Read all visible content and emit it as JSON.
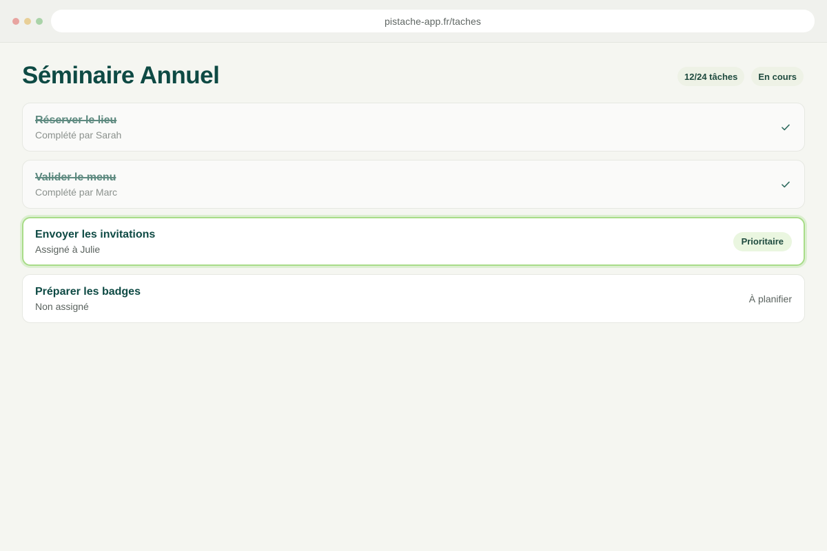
{
  "browser": {
    "url": "pistache-app.fr/taches"
  },
  "header": {
    "title": "Séminaire Annuel",
    "progress_label": "12/24 tâches",
    "status_label": "En cours"
  },
  "tasks": [
    {
      "title": "Réserver le lieu",
      "subtitle": "Complété par Sarah",
      "state": "done",
      "icon": "check-icon"
    },
    {
      "title": "Valider le menu",
      "subtitle": "Complété par Marc",
      "state": "done",
      "icon": "check-icon"
    },
    {
      "title": "Envoyer les invitations",
      "subtitle": "Assigné à Julie",
      "state": "active",
      "badge": "Prioritaire"
    },
    {
      "title": "Préparer les badges",
      "subtitle": "Non assigné",
      "state": "todo",
      "status": "À planifier"
    }
  ],
  "colors": {
    "accent": "#0e4a44",
    "active_border": "#a8dc88",
    "background": "#f5f6f1"
  }
}
